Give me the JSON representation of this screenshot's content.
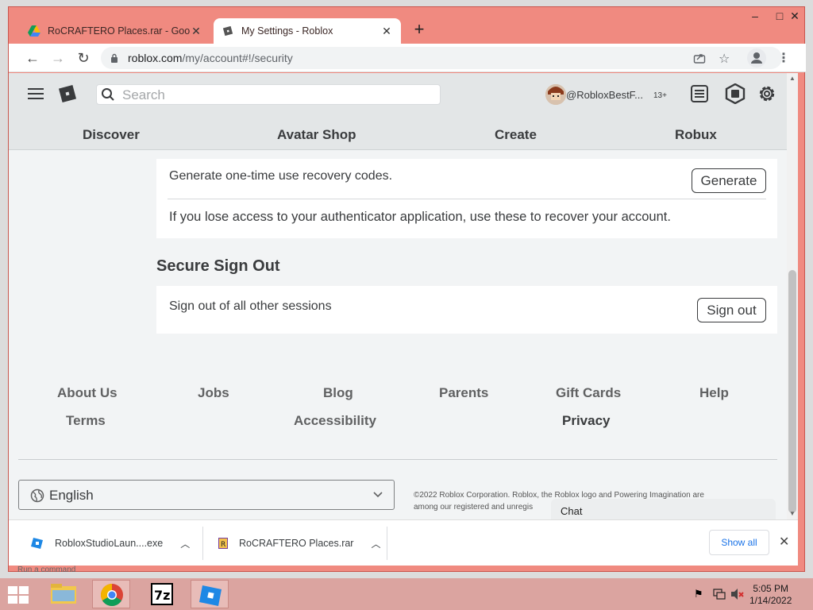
{
  "browser": {
    "tabs": [
      {
        "label": "RoCRAFTERO Places.rar - Google",
        "active": false
      },
      {
        "label": "My Settings - Roblox",
        "active": true
      }
    ],
    "url": {
      "host": "roblox.com",
      "path": "/my/account#!/security"
    },
    "controls": {
      "minimize": "–",
      "maximize": "□",
      "close": "✕"
    }
  },
  "header": {
    "search_placeholder": "Search",
    "username": "@RobloxBestF...",
    "age_badge": "13+",
    "nav": [
      "Discover",
      "Avatar Shop",
      "Create",
      "Robux"
    ]
  },
  "recovery": {
    "title": "Generate one-time use recovery codes.",
    "button": "Generate",
    "description": "If you lose access to your authenticator application, use these to recover your account."
  },
  "secure_signout": {
    "heading": "Secure Sign Out",
    "text": "Sign out of all other sessions",
    "button": "Sign out"
  },
  "footer": {
    "links_row1": [
      "About Us",
      "Jobs",
      "Blog",
      "Parents",
      "Gift Cards",
      "Help"
    ],
    "links_row2": [
      "Terms",
      "Accessibility",
      "Privacy"
    ],
    "language": "English",
    "legal_line1": "©2022 Roblox Corporation. Roblox, the Roblox logo and Powering Imagination are",
    "legal_line2": "among our registered and unregis",
    "chat": "Chat"
  },
  "downloads": {
    "items": [
      "RobloxStudioLaun....exe",
      "RoCRAFTERO Places.rar"
    ],
    "show_all": "Show all"
  },
  "taskbar": {
    "time": "5:05 PM",
    "date": "1/14/2022",
    "run_command": "Run a command"
  },
  "colors": {
    "window_frame": "#f08a80",
    "roblox_bg": "#f2f4f5",
    "taskbar": "#dba4a0",
    "link_blue": "#1a73e8"
  }
}
